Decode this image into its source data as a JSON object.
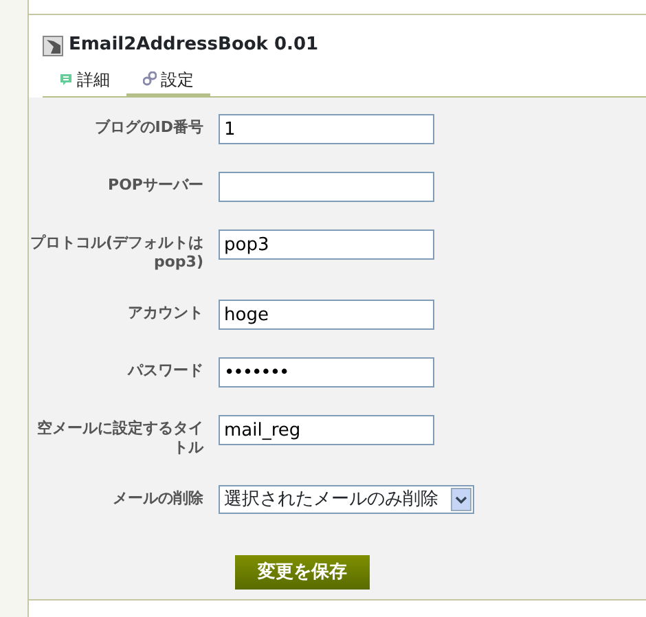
{
  "plugin": {
    "title": "Email2AddressBook 0.01"
  },
  "tabs": [
    {
      "label": "詳細",
      "selected": false
    },
    {
      "label": "設定",
      "selected": true
    }
  ],
  "fields": [
    {
      "label": "ブログのID番号",
      "kind": "text",
      "value": "1"
    },
    {
      "label": "POPサーバー",
      "kind": "text"
    },
    {
      "label": "プロトコル(デフォルトはpop3)",
      "kind": "text",
      "value": "pop3"
    },
    {
      "label": "アカウント",
      "kind": "text",
      "value": "hoge"
    },
    {
      "label": "パスワード",
      "kind": "password",
      "value": "•••••••"
    },
    {
      "label": "空メールに設定するタイトル",
      "kind": "text",
      "value": "mail_reg"
    },
    {
      "label": "メールの削除",
      "kind": "select",
      "value": "選択されたメールのみ削除"
    }
  ],
  "save_button": "変更を保存"
}
